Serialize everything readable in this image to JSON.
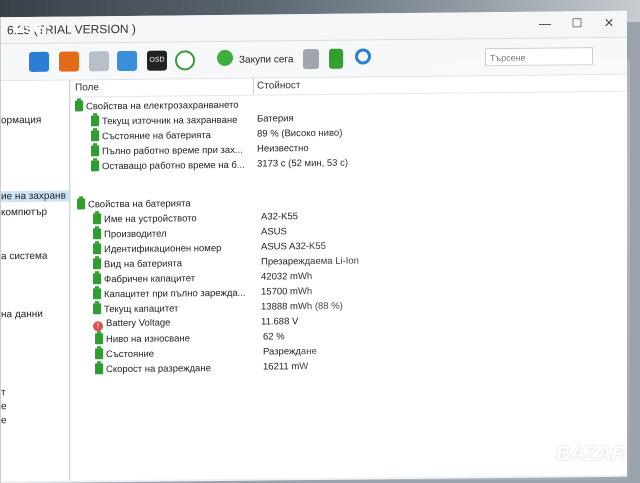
{
  "overlay": {
    "user_label": "user",
    "watermark": "BAZAR"
  },
  "window": {
    "title": "6.25 (TRIAL VERSION )",
    "controls": [
      "—",
      "☐",
      "✕"
    ]
  },
  "toolbar": {
    "buy_label": "Закупи сега",
    "search_placeholder": "Търсене"
  },
  "left_pane": {
    "items": [
      {
        "label": "ормация",
        "selected": false
      },
      {
        "label": "ие на захранв",
        "selected": true
      },
      {
        "label": "компютър",
        "selected": false
      },
      {
        "label": "а система",
        "selected": false
      },
      {
        "label": "на данни",
        "selected": false
      },
      {
        "label": "т",
        "selected": false
      },
      {
        "label": "е",
        "selected": false
      },
      {
        "label": "е",
        "selected": false
      }
    ]
  },
  "table": {
    "headers": {
      "field": "Поле",
      "value": "Стойност"
    },
    "groups": [
      {
        "title": "Свойства на електрозахранването",
        "rows": [
          {
            "field": "Текущ източник на захранване",
            "value": "Батерия",
            "icon": "battery-icon"
          },
          {
            "field": "Състояние на батерията",
            "value": "89 % (Високо ниво)",
            "icon": "battery-icon"
          },
          {
            "field": "Пълно работно време при зах...",
            "value": "Неизвестно",
            "icon": "battery-icon"
          },
          {
            "field": "Оставащо работно време на б...",
            "value": "3173 с (52 мин, 53 с)",
            "icon": "battery-icon"
          }
        ]
      },
      {
        "title": "Свойства на батерията",
        "rows": [
          {
            "field": "Име на устройството",
            "value": "A32-K55",
            "icon": "battery-icon"
          },
          {
            "field": "Производител",
            "value": "ASUS",
            "icon": "battery-icon"
          },
          {
            "field": "Идентификационен номер",
            "value": "ASUS A32-K55",
            "icon": "battery-icon"
          },
          {
            "field": "Вид на батерията",
            "value": "Презареждаема Li-Ion",
            "icon": "battery-icon"
          },
          {
            "field": "Фабричен капацитет",
            "value": "42032 mWh",
            "icon": "battery-icon"
          },
          {
            "field": "Капацитет при пълно зарежда...",
            "value": "15700 mWh",
            "icon": "battery-icon"
          },
          {
            "field": "Текущ капацитет",
            "value": "13888 mWh  (88 %)",
            "icon": "battery-icon"
          },
          {
            "field": "Battery Voltage",
            "value": "11.688 V",
            "icon": "voltage-warning-icon"
          },
          {
            "field": "Ниво на износване",
            "value": "62 %",
            "icon": "battery-icon"
          },
          {
            "field": "Състояние",
            "value": "Разреждане",
            "icon": "battery-icon"
          },
          {
            "field": "Скорост на разреждане",
            "value": "16211 mW",
            "icon": "battery-icon"
          }
        ]
      }
    ]
  },
  "colors": {
    "accent_green": "#2e9e2e",
    "selection": "#cde3f7"
  }
}
